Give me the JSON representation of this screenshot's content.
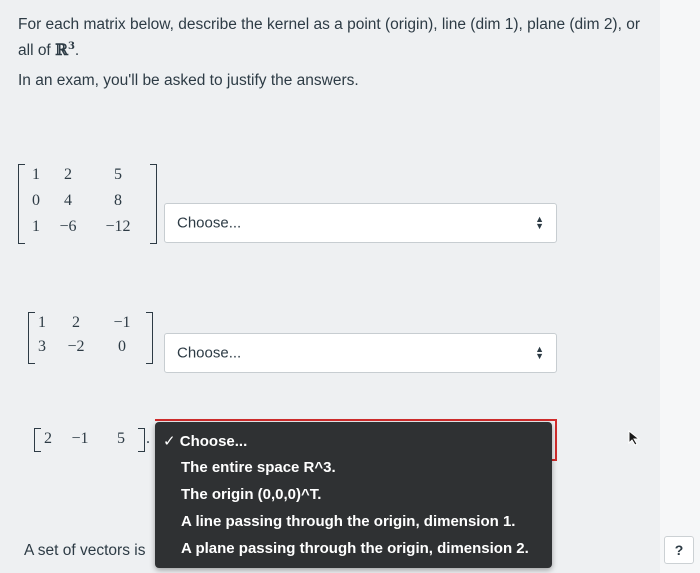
{
  "question": {
    "prompt_part1": "For each matrix below, describe the kernel as a point (origin), line (dim 1), plane (dim 2), or all of ",
    "prompt_math": "ℝ",
    "prompt_sup": "3",
    "prompt_end": ".",
    "note": "In an exam, you'll be asked to justify the answers."
  },
  "matrices": {
    "m1": [
      [
        "1",
        "2",
        "5"
      ],
      [
        "0",
        "4",
        "8"
      ],
      [
        "1",
        "−6",
        "−12"
      ]
    ],
    "m2": [
      [
        "1",
        "2",
        "−1"
      ],
      [
        "3",
        "−2",
        "0"
      ]
    ],
    "m3": [
      [
        "2",
        "−1",
        "5"
      ]
    ],
    "m3_trail": "."
  },
  "selects": {
    "s1": {
      "value": "Choose..."
    },
    "s2": {
      "value": "Choose..."
    }
  },
  "dropdown": {
    "check": "✓",
    "options": [
      "Choose...",
      "The entire space R^3.",
      "The origin (0,0,0)^T.",
      "A line passing through the origin, dimension 1.",
      "A plane passing through the origin, dimension 2."
    ]
  },
  "footer": {
    "sets_text": "A set of vectors is",
    "help_label": "?"
  },
  "colors": {
    "dropdown_bg": "#2f3133",
    "focus_red": "#d12c2c",
    "text": "#2d3b45"
  }
}
